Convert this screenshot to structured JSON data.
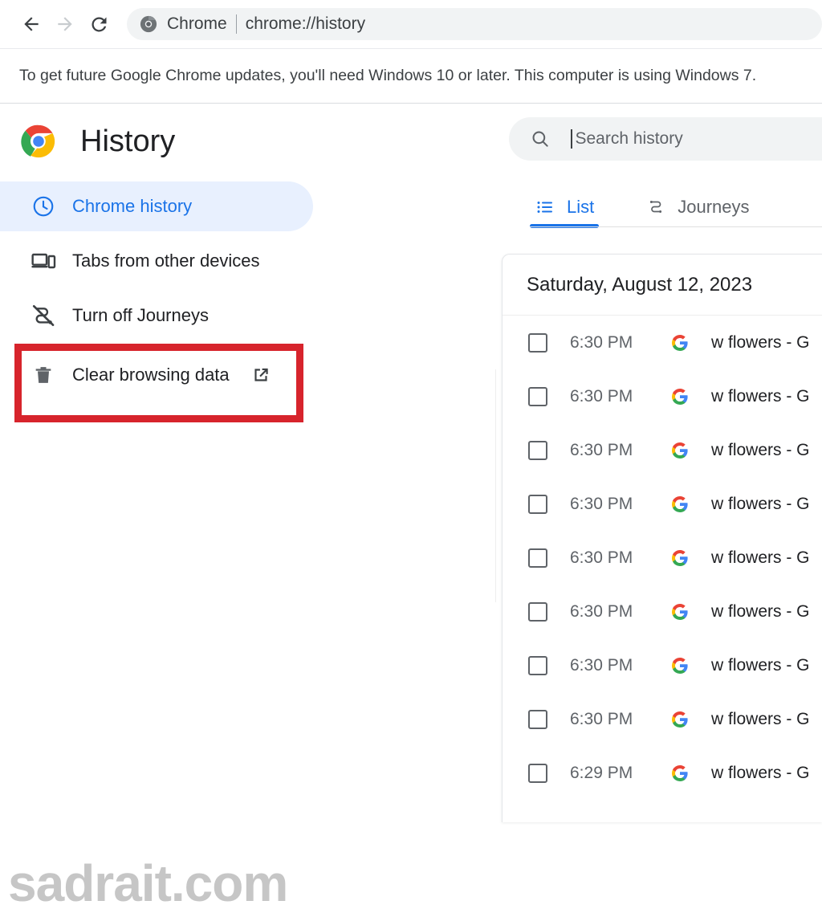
{
  "toolbar": {
    "back_icon": "back-arrow-icon",
    "forward_icon": "forward-arrow-icon",
    "reload_icon": "reload-icon",
    "app_name": "Chrome",
    "url": "chrome://history",
    "chrome_icon": "chrome-logo-icon"
  },
  "infobar": {
    "message": "To get future Google Chrome updates, you'll need Windows 10 or later. This computer is using Windows 7."
  },
  "sidebar": {
    "title": "History",
    "logo_icon": "chrome-logo-icon",
    "items": [
      {
        "label": "Chrome history",
        "icon": "clock-icon",
        "active": true
      },
      {
        "label": "Tabs from other devices",
        "icon": "devices-icon",
        "active": false
      },
      {
        "label": "Turn off Journeys",
        "icon": "journeys-off-icon",
        "active": false
      },
      {
        "label": "Clear browsing data",
        "icon": "trash-icon",
        "trailing_icon": "external-link-icon",
        "active": false,
        "highlighted": true
      }
    ]
  },
  "highlight": {
    "color": "#d7242c"
  },
  "watermark": {
    "text": "sadrait.com"
  },
  "search": {
    "placeholder": "Search history",
    "icon": "search-icon",
    "value": ""
  },
  "tabs": [
    {
      "label": "List",
      "icon": "list-icon",
      "selected": true
    },
    {
      "label": "Journeys",
      "icon": "journeys-icon",
      "selected": false
    }
  ],
  "history": {
    "date_header": "Saturday, August 12, 2023",
    "rows": [
      {
        "time": "6:30 PM",
        "favicon": "google-g-icon",
        "title": "w flowers - G"
      },
      {
        "time": "6:30 PM",
        "favicon": "google-g-icon",
        "title": "w flowers - G"
      },
      {
        "time": "6:30 PM",
        "favicon": "google-g-icon",
        "title": "w flowers - G"
      },
      {
        "time": "6:30 PM",
        "favicon": "google-g-icon",
        "title": "w flowers - G"
      },
      {
        "time": "6:30 PM",
        "favicon": "google-g-icon",
        "title": "w flowers - G"
      },
      {
        "time": "6:30 PM",
        "favicon": "google-g-icon",
        "title": "w flowers - G"
      },
      {
        "time": "6:30 PM",
        "favicon": "google-g-icon",
        "title": "w flowers - G"
      },
      {
        "time": "6:30 PM",
        "favicon": "google-g-icon",
        "title": "w flowers - G"
      },
      {
        "time": "6:29 PM",
        "favicon": "google-g-icon",
        "title": "w flowers - G"
      }
    ]
  },
  "colors": {
    "accent": "#1a73e8",
    "active_pill_bg": "#e8f0fe",
    "highlight_red": "#d7242c",
    "text_primary": "#202124",
    "text_secondary": "#5f6368"
  }
}
